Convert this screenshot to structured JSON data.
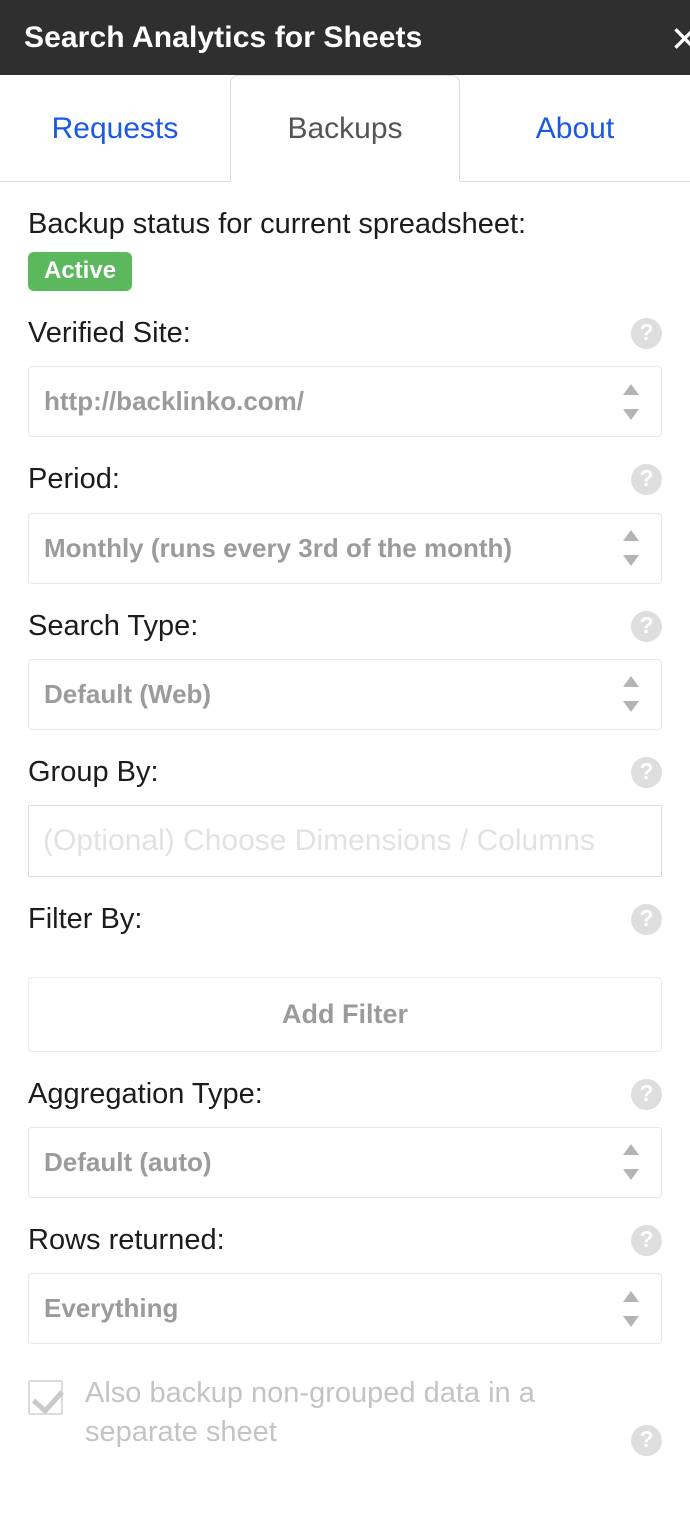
{
  "titlebar": {
    "title": "Search Analytics for Sheets",
    "close_label": "×",
    "close_icon_name": "close-icon"
  },
  "tabs": [
    {
      "label": "Requests",
      "active": false
    },
    {
      "label": "Backups",
      "active": true
    },
    {
      "label": "About",
      "active": false
    }
  ],
  "backup_status": {
    "label": "Backup status for current spreadsheet:",
    "badge": "Active",
    "badge_color": "#5cb85c"
  },
  "help_glyph": "?",
  "fields": {
    "verified_site": {
      "label": "Verified Site:",
      "value": "http://backlinko.com/",
      "options": [
        "http://backlinko.com/"
      ]
    },
    "period": {
      "label": "Period:",
      "value": "Monthly (runs every 3rd of the month)",
      "options": [
        "Monthly (runs every 3rd of the month)"
      ]
    },
    "search_type": {
      "label": "Search Type:",
      "value": "Default (Web)",
      "options": [
        "Default (Web)"
      ]
    },
    "group_by": {
      "label": "Group By:",
      "placeholder": "(Optional) Choose Dimensions / Columns",
      "value": ""
    },
    "filter_by": {
      "label": "Filter By:",
      "add_button": "Add Filter"
    },
    "aggregation_type": {
      "label": "Aggregation Type:",
      "value": "Default (auto)",
      "options": [
        "Default (auto)"
      ]
    },
    "rows_returned": {
      "label": "Rows returned:",
      "value": "Everything",
      "options": [
        "Everything"
      ]
    },
    "non_grouped_backup": {
      "label": "Also backup non-grouped data in a separate sheet",
      "checked": true
    }
  },
  "colors": {
    "titlebar_bg": "#2f2f2f",
    "tab_link": "#1a58e8",
    "tab_active_text": "#555555",
    "label_text": "#1c1c1c",
    "control_text": "#9b9b9b",
    "help_bg": "#dedede"
  }
}
